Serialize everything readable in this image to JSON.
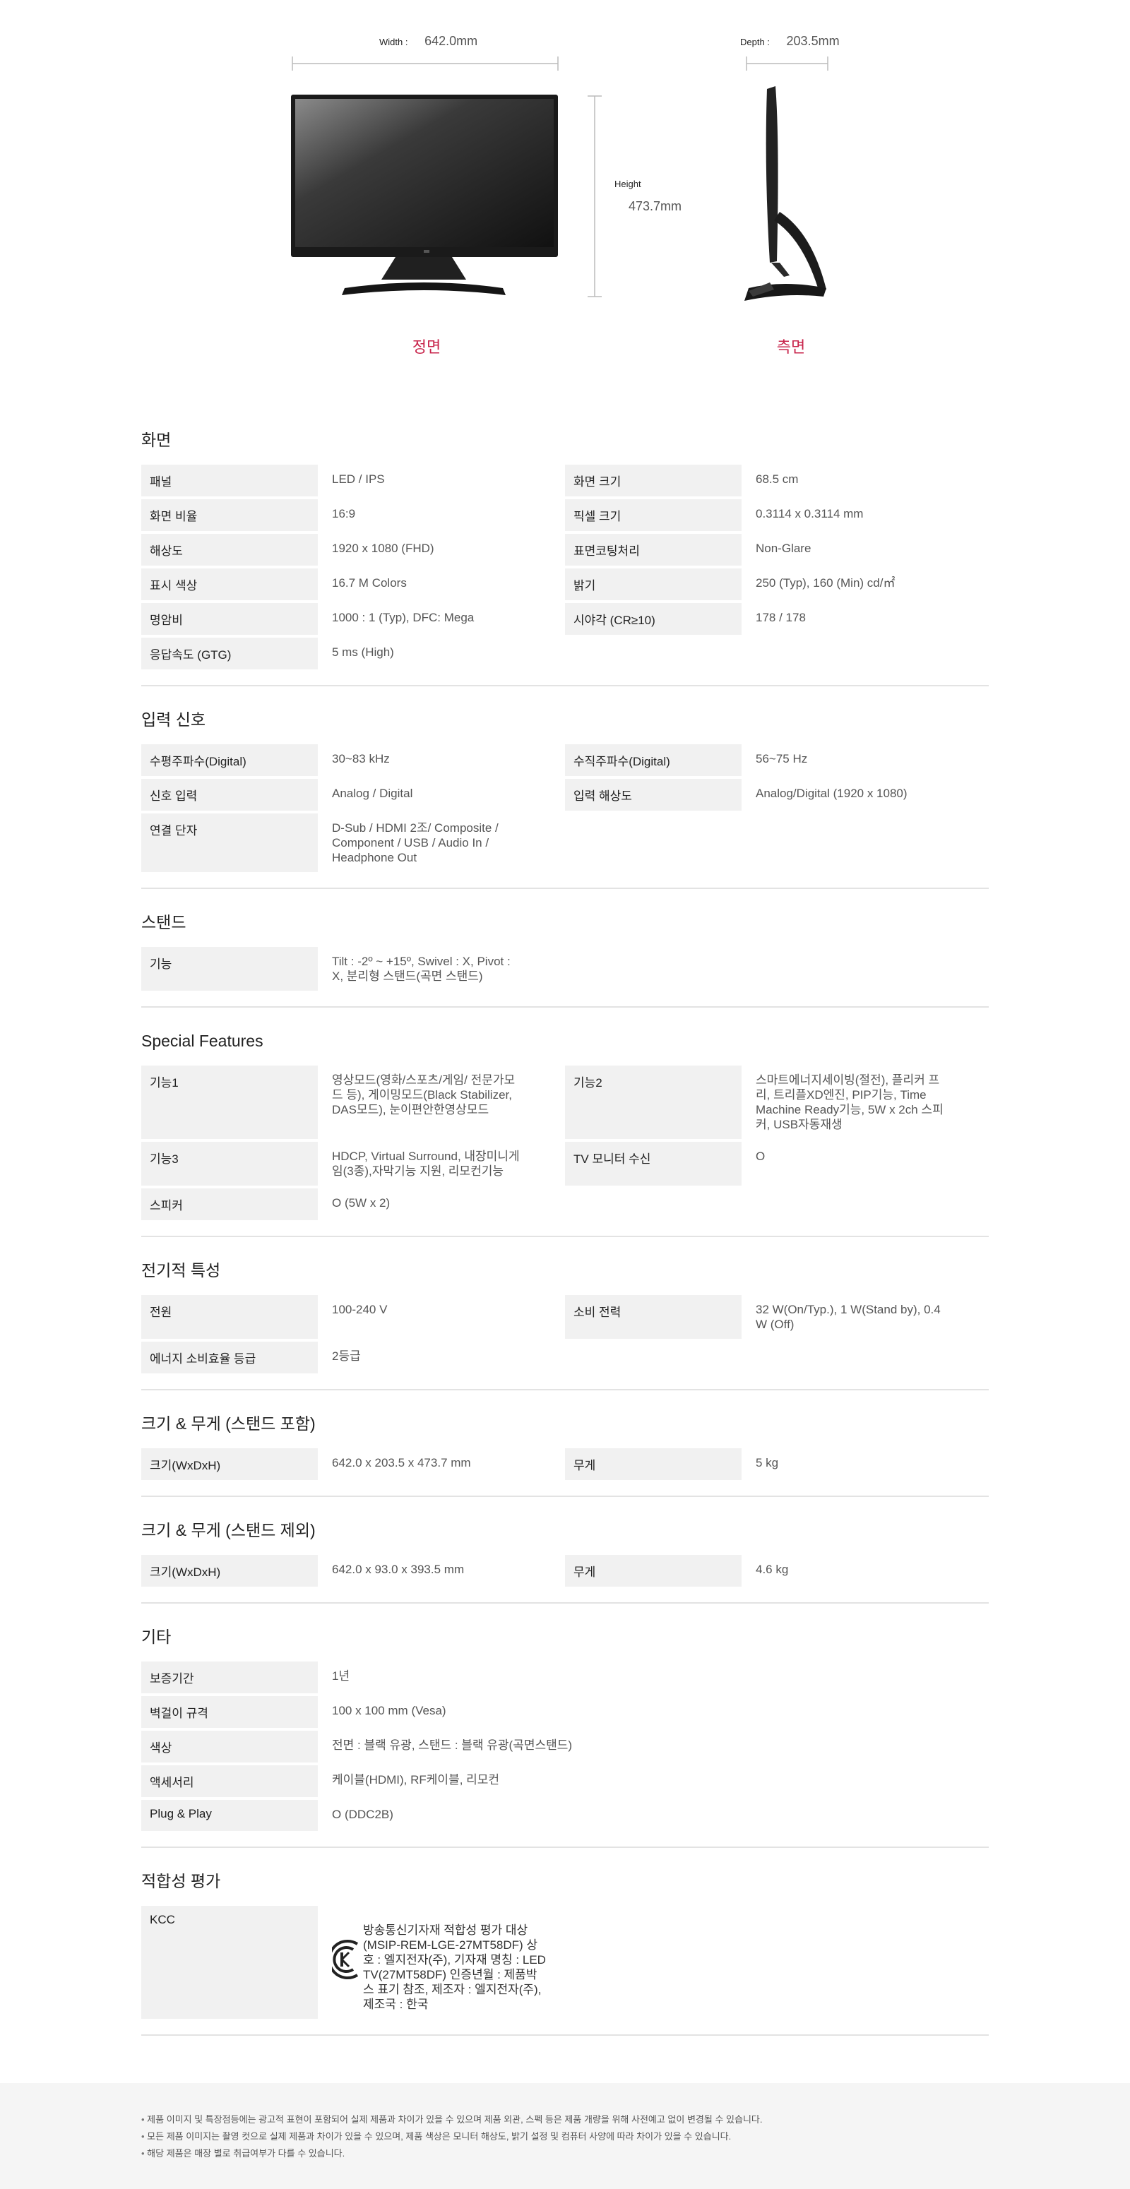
{
  "dimensions": {
    "width_label": "Width : ",
    "width_value": "642.0mm",
    "depth_label": "Depth : ",
    "depth_value": "203.5mm",
    "height_label": "Height",
    "height_value": "473.7mm",
    "front_label": "정면",
    "side_label": "측면"
  },
  "sections": [
    {
      "title": "화면",
      "rows": [
        {
          "label": "패널",
          "value": "LED / IPS"
        },
        {
          "label": "화면 크기",
          "value": "68.5 cm"
        },
        {
          "label": "화면 비율",
          "value": "16:9"
        },
        {
          "label": "픽셀 크기",
          "value": "0.3114 x 0.3114 mm"
        },
        {
          "label": "해상도",
          "value": "1920 x 1080 (FHD)"
        },
        {
          "label": "표면코팅처리",
          "value": "Non-Glare"
        },
        {
          "label": "표시 색상",
          "value": "16.7 M Colors"
        },
        {
          "label": "밝기",
          "value": "250 (Typ), 160 (Min) cd/㎡"
        },
        {
          "label": "명암비",
          "value": "1000 : 1 (Typ), DFC: Mega"
        },
        {
          "label": "시야각 (CR≥10)",
          "value": "178 / 178"
        },
        {
          "label": "응답속도 (GTG)",
          "value": "5 ms (High)"
        }
      ]
    },
    {
      "title": "입력 신호",
      "rows": [
        {
          "label": "수평주파수(Digital)",
          "value": "30~83 kHz"
        },
        {
          "label": "수직주파수(Digital)",
          "value": "56~75 Hz"
        },
        {
          "label": "신호 입력",
          "value": "Analog / Digital"
        },
        {
          "label": "입력 해상도",
          "value": "Analog/Digital (1920 x 1080)"
        },
        {
          "label": "연결 단자",
          "value": "D-Sub / HDMI 2조/ Composite / Component / USB / Audio In / Headphone Out"
        }
      ]
    },
    {
      "title": "스탠드",
      "rows": [
        {
          "label": "기능",
          "value": "Tilt : -2º ~ +15º, Swivel : X, Pivot : X, 분리형 스탠드(곡면 스탠드)"
        }
      ]
    },
    {
      "title": "Special Features",
      "rows": [
        {
          "label": "기능1",
          "value": "영상모드(영화/스포츠/게임/ 전문가모드 등), 게이밍모드(Black Stabilizer, DAS모드), 눈이편안한영상모드"
        },
        {
          "label": "기능2",
          "value": "스마트에너지세이빙(절전), 플리커 프리, 트리플XD엔진, PIP기능, Time Machine Ready기능, 5W x 2ch 스피커, USB자동재생"
        },
        {
          "label": "기능3",
          "value": "HDCP, Virtual Surround, 내장미니게임(3종),자막기능 지원, 리모컨기능"
        },
        {
          "label": "TV 모니터 수신",
          "value": "O"
        },
        {
          "label": "스피커",
          "value": "O (5W x 2)"
        }
      ]
    },
    {
      "title": "전기적 특성",
      "rows": [
        {
          "label": "전원",
          "value": "100-240 V"
        },
        {
          "label": "소비 전력",
          "value": "32 W(On/Typ.), 1 W(Stand by), 0.4 W (Off)"
        },
        {
          "label": "에너지 소비효율 등급",
          "value": "2등급"
        }
      ]
    },
    {
      "title": "크기 & 무게 (스탠드 포함)",
      "rows": [
        {
          "label": "크기(WxDxH)",
          "value": "642.0 x 203.5 x 473.7 mm"
        },
        {
          "label": "무게",
          "value": "5 kg"
        }
      ]
    },
    {
      "title": "크기 & 무게 (스탠드 제외)",
      "rows": [
        {
          "label": "크기(WxDxH)",
          "value": "642.0 x 93.0 x 393.5 mm"
        },
        {
          "label": "무게",
          "value": "4.6 kg"
        }
      ]
    },
    {
      "title": "기타",
      "full": true,
      "rows": [
        {
          "label": "보증기간",
          "value": "1년"
        },
        {
          "label": "벽걸이 규격",
          "value": "100 x 100 mm (Vesa)"
        },
        {
          "label": "색상",
          "value": "전면 : 블랙 유광, 스탠드 : 블랙 유광(곡면스탠드)"
        },
        {
          "label": "액세서리",
          "value": "케이블(HDMI), RF케이블, 리모컨"
        },
        {
          "label": "Plug & Play",
          "value": "O (DDC2B)"
        }
      ]
    }
  ],
  "kcc": {
    "title": "적합성 평가",
    "label": "KCC",
    "text": "방송통신기자재 적합성 평가 대상 (MSIP-REM-LGE-27MT58DF) 상호 : 엘지전자(주), 기자재 명칭 : LED TV(27MT58DF) 인증년월 : 제품박스 표기 참조, 제조자 : 엘지전자(주), 제조국 : 한국"
  },
  "notes": [
    "제품 이미지 및 특장점등에는 광고적 표현이 포함되어 실제 제품과 차이가 있을 수 있으며 제품 외관, 스펙 등은 제품 개량을 위해 사전예고 없이 변경될 수 있습니다.",
    "모든 제품 이미지는 촬영 컷으로 실제 제품과 차이가 있을 수 있으며, 제품 색상은 모니터 해상도, 밝기 설정 및 컴퓨터 사양에 따라 차이가 있을 수 있습니다.",
    "해당 제품은 매장 별로 취급여부가 다를 수 있습니다."
  ]
}
